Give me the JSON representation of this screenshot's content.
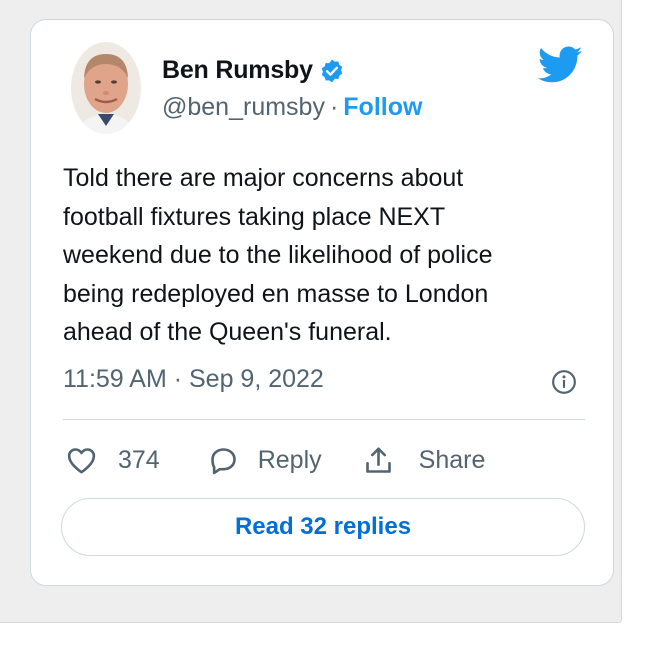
{
  "author": {
    "name": "Ben Rumsby",
    "handle": "@ben_rumsby",
    "separator": "·",
    "follow_label": "Follow",
    "verified": true
  },
  "tweet": {
    "text_lines": [
      "Told there are major concerns about",
      "football fixtures taking place NEXT",
      "weekend due to the likelihood of police",
      "being redeployed en masse to London",
      "ahead of the Queen's funeral."
    ],
    "timestamp": "11:59 AM · Sep 9, 2022"
  },
  "actions": {
    "like_count": "374",
    "reply_label": "Reply",
    "share_label": "Share"
  },
  "read_replies_label": "Read 32 replies",
  "icons": {
    "brand": "twitter-bird-icon",
    "verified": "verified-badge-icon",
    "info": "info-icon",
    "like": "heart-icon",
    "reply": "speech-bubble-icon",
    "share": "share-upload-icon"
  },
  "colors": {
    "accent": "#1d9bf0",
    "link": "#006fd6",
    "text": "#0f1419",
    "secondary": "#536471",
    "border": "#cfd9de",
    "background": "#eeeeee"
  }
}
